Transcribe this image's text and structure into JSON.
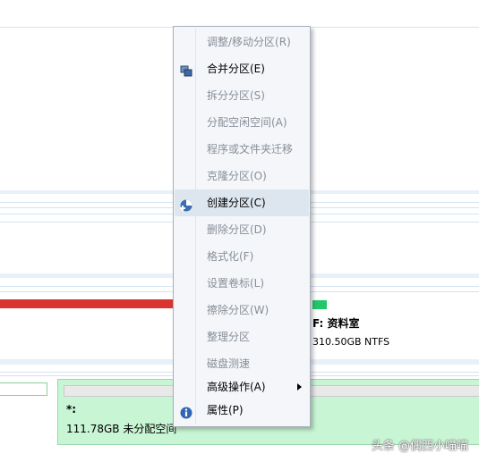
{
  "context_menu": {
    "items": [
      {
        "label": "调整/移动分区(R)",
        "enabled": false
      },
      {
        "label": "合并分区(E)",
        "enabled": true,
        "icon": "merge-icon"
      },
      {
        "label": "拆分分区(S)",
        "enabled": false
      },
      {
        "label": "分配空闲空间(A)",
        "enabled": false
      },
      {
        "label": "程序或文件夹迁移",
        "enabled": false
      },
      {
        "label": "克隆分区(O)",
        "enabled": false
      },
      {
        "label": "创建分区(C)",
        "enabled": true,
        "icon": "create-partition-icon",
        "highlighted": true
      },
      {
        "label": "删除分区(D)",
        "enabled": false
      },
      {
        "label": "格式化(F)",
        "enabled": false
      },
      {
        "label": "设置卷标(L)",
        "enabled": false
      },
      {
        "label": "擦除分区(W)",
        "enabled": false
      },
      {
        "label": "整理分区",
        "enabled": false
      },
      {
        "label": "磁盘测速",
        "enabled": false
      },
      {
        "label": "高级操作(A)",
        "enabled": true,
        "submenu": true
      },
      {
        "label": "属性(P)",
        "enabled": true,
        "icon": "info-icon"
      }
    ]
  },
  "volume_f": {
    "title": "F: 资料室",
    "size": "310.50GB NTFS"
  },
  "unallocated": {
    "letter": "*:",
    "description": "111.78GB 未分配空间"
  },
  "watermark": "头条 @偶西小喵喵",
  "colors": {
    "used_bar": "#d9342f",
    "free_bar": "#22c76a",
    "unallocated_bg": "#c8f5d4",
    "menu_highlight": "#dde6ef"
  }
}
